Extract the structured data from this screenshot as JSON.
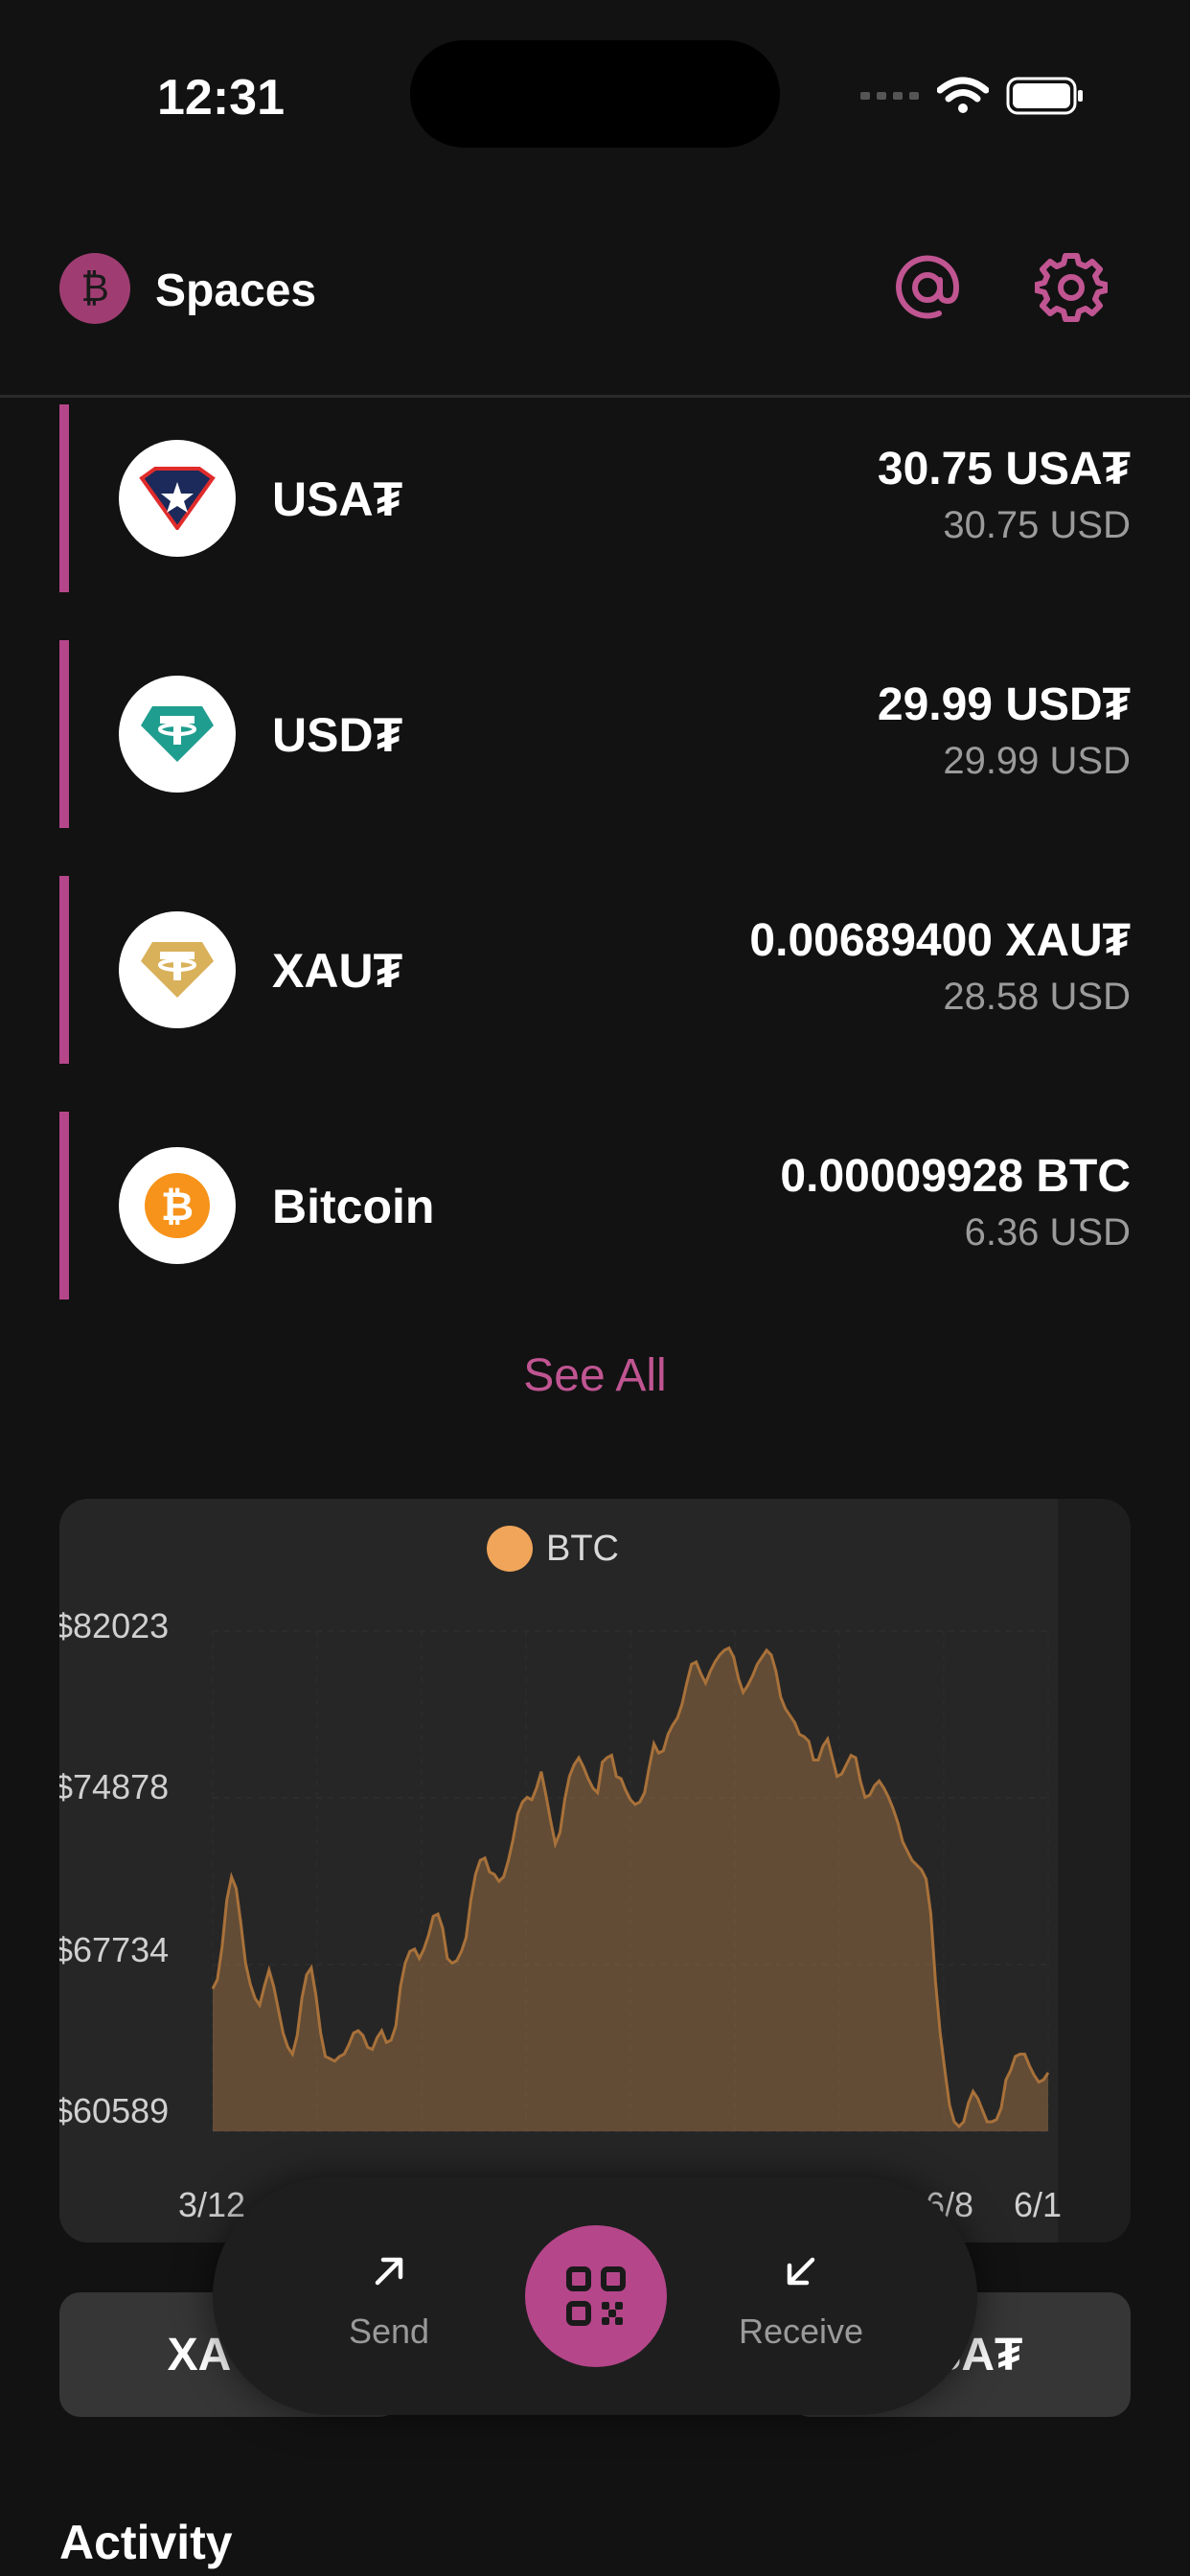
{
  "status_bar": {
    "time": "12:31"
  },
  "header": {
    "logo_symbol": "₿",
    "title": "Spaces"
  },
  "assets": [
    {
      "name": "USA₮",
      "amount": "30.75 USA₮",
      "usd": "30.75 USD",
      "icon": "usat-icon"
    },
    {
      "name": "USD₮",
      "amount": "29.99 USD₮",
      "usd": "29.99 USD",
      "icon": "tether-icon"
    },
    {
      "name": "XAU₮",
      "amount": "0.00689400 XAU₮",
      "usd": "28.58 USD",
      "icon": "tether-gold-icon"
    },
    {
      "name": "Bitcoin",
      "amount": "0.00009928 BTC",
      "usd": "6.36 USD",
      "icon": "bitcoin-icon"
    }
  ],
  "see_all_label": "See All",
  "chart_data": {
    "type": "area",
    "legend": [
      "BTC"
    ],
    "series": [
      {
        "name": "BTC",
        "color": "#f0a55a"
      }
    ],
    "y_ticks": [
      "$82023",
      "$74878",
      "$67734",
      "$60589"
    ],
    "x_ticks": [
      "3/12",
      "6/8",
      "6/1"
    ],
    "ylim": [
      60589,
      82023
    ],
    "values": [
      66700,
      67100,
      68500,
      70500,
      71500,
      71000,
      69500,
      67800,
      66900,
      66300,
      66000,
      66800,
      67500,
      66800,
      65800,
      64800,
      64200,
      63900,
      64700,
      66300,
      67300,
      67600,
      66400,
      64800,
      63800,
      63700,
      63600,
      63800,
      63900,
      64300,
      64800,
      64900,
      64700,
      64200,
      64100,
      64600,
      64900,
      64400,
      64500,
      65100,
      66800,
      67800,
      68300,
      68400,
      68000,
      68400,
      69000,
      69800,
      69900,
      69300,
      68000,
      67800,
      67900,
      68300,
      68900,
      70500,
      71600,
      72200,
      72300,
      71700,
      71600,
      71300,
      71500,
      72200,
      73100,
      74200,
      74700,
      74900,
      74800,
      75300,
      76000,
      75000,
      73900,
      72900,
      73400,
      74800,
      75800,
      76300,
      76600,
      76200,
      75700,
      75300,
      75100,
      76400,
      76600,
      76700,
      75800,
      75700,
      75200,
      74800,
      74600,
      74700,
      75100,
      76200,
      77200,
      76800,
      76900,
      77600,
      78000,
      78300,
      78900,
      79800,
      80600,
      80700,
      80200,
      79800,
      80300,
      80700,
      81000,
      81200,
      81300,
      80900,
      80000,
      79400,
      79700,
      80100,
      80600,
      80900,
      81200,
      81000,
      80300,
      79200,
      78700,
      78400,
      78100,
      77600,
      77500,
      77300,
      76500,
      76500,
      77100,
      77400,
      76600,
      75800,
      75900,
      76300,
      76700,
      76600,
      75600,
      74900,
      75000,
      75400,
      75600,
      75300,
      74900,
      74400,
      73800,
      73000,
      72600,
      72200,
      72000,
      71800,
      71400,
      69900,
      67000,
      64800,
      63200,
      61700,
      61000,
      60800,
      61000,
      61800,
      62300,
      62000,
      61500,
      61000,
      61000,
      61100,
      61600,
      62800,
      63200,
      63800,
      63900,
      63900,
      63400,
      63000,
      62700,
      62800,
      63100
    ],
    "grid": true
  },
  "tabs": [
    "XAU₮",
    "USA₮"
  ],
  "actions": {
    "send_label": "Send",
    "receive_label": "Receive"
  },
  "activity_label": "Activity"
}
